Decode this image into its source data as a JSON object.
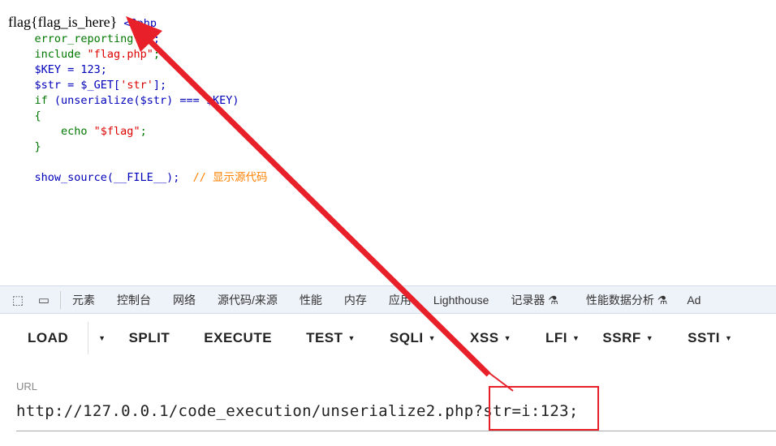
{
  "code": {
    "flag_output": "flag{flag_is_here}",
    "open_tag": "<?php",
    "lines": [
      {
        "k": "error_reporting",
        "d": "(0);"
      },
      {
        "k": "include ",
        "s": "\"flag.php\"",
        "d": ";"
      },
      {
        "d": "$KEY = 123;"
      },
      {
        "d": "$str = $_GET[",
        "s": "'str'",
        "e": "];"
      },
      {
        "k": "if ",
        "d": "(unserialize($str) === $KEY)"
      },
      {
        "k": "{"
      },
      {
        "k": "echo ",
        "s": "\"$flag\"",
        "e": ";"
      },
      {
        "k": "}"
      },
      {
        "d": "show_source(__FILE__);",
        "e": "  ",
        "c": "// 显示源代码"
      }
    ]
  },
  "devtools": {
    "tabs": [
      "元素",
      "控制台",
      "网络",
      "源代码/来源",
      "性能",
      "内存",
      "应用",
      "Lighthouse",
      "记录器 ⚗",
      "性能数据分析 ⚗",
      "Ad"
    ]
  },
  "toolbar": {
    "load": "LOAD",
    "split": "SPLIT",
    "execute": "EXECUTE",
    "test": "TEST",
    "sqli": "SQLI",
    "xss": "XSS",
    "lfi": "LFI",
    "ssrf": "SSRF",
    "ssti": "SSTI"
  },
  "url": {
    "label": "URL",
    "base": "http://127.0.0.1/code_execution/unserialize2.php",
    "query": "?str=i:123;"
  },
  "annotation": {
    "color": "#e8202a"
  }
}
